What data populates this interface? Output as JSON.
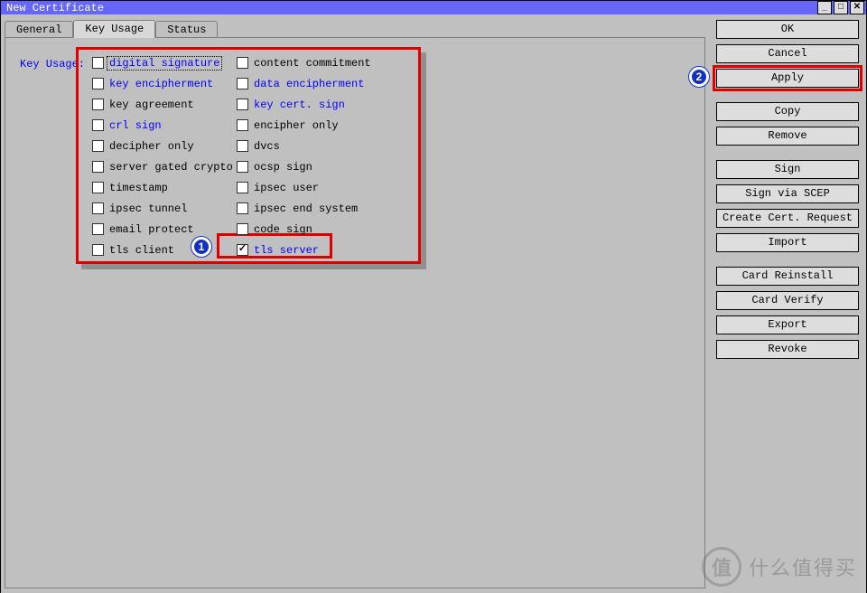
{
  "window": {
    "title": "New Certificate"
  },
  "tabs": {
    "general": "General",
    "key_usage": "Key Usage",
    "status": "Status",
    "active": "key_usage"
  },
  "section_label": "Key Usage:",
  "options": {
    "row0": {
      "left": {
        "label": "digital signature",
        "blue": true,
        "checked": false,
        "focused": true
      },
      "right": {
        "label": "content commitment",
        "blue": false,
        "checked": false
      }
    },
    "row1": {
      "left": {
        "label": "key encipherment",
        "blue": true,
        "checked": false
      },
      "right": {
        "label": "data encipherment",
        "blue": true,
        "checked": false
      }
    },
    "row2": {
      "left": {
        "label": "key agreement",
        "blue": false,
        "checked": false
      },
      "right": {
        "label": "key cert. sign",
        "blue": true,
        "checked": false
      }
    },
    "row3": {
      "left": {
        "label": "crl sign",
        "blue": true,
        "checked": false
      },
      "right": {
        "label": "encipher only",
        "blue": false,
        "checked": false
      }
    },
    "row4": {
      "left": {
        "label": "decipher only",
        "blue": false,
        "checked": false
      },
      "right": {
        "label": "dvcs",
        "blue": false,
        "checked": false
      }
    },
    "row5": {
      "left": {
        "label": "server gated crypto",
        "blue": false,
        "checked": false
      },
      "right": {
        "label": "ocsp sign",
        "blue": false,
        "checked": false
      }
    },
    "row6": {
      "left": {
        "label": "timestamp",
        "blue": false,
        "checked": false
      },
      "right": {
        "label": "ipsec user",
        "blue": false,
        "checked": false
      }
    },
    "row7": {
      "left": {
        "label": "ipsec tunnel",
        "blue": false,
        "checked": false
      },
      "right": {
        "label": "ipsec end system",
        "blue": false,
        "checked": false
      }
    },
    "row8": {
      "left": {
        "label": "email protect",
        "blue": false,
        "checked": false
      },
      "right": {
        "label": "code sign",
        "blue": false,
        "checked": false
      }
    },
    "row9": {
      "left": {
        "label": "tls client",
        "blue": false,
        "checked": false
      },
      "right": {
        "label": "tls server",
        "blue": true,
        "checked": true
      }
    }
  },
  "buttons": {
    "ok": "OK",
    "cancel": "Cancel",
    "apply": "Apply",
    "copy": "Copy",
    "remove": "Remove",
    "sign": "Sign",
    "sign_scep": "Sign via SCEP",
    "create_req": "Create Cert. Request",
    "import": "Import",
    "card_reinstall": "Card Reinstall",
    "card_verify": "Card Verify",
    "export": "Export",
    "revoke": "Revoke"
  },
  "callouts": {
    "one": "1",
    "two": "2"
  },
  "watermark": {
    "glyph": "值",
    "text": "什么值得买"
  }
}
